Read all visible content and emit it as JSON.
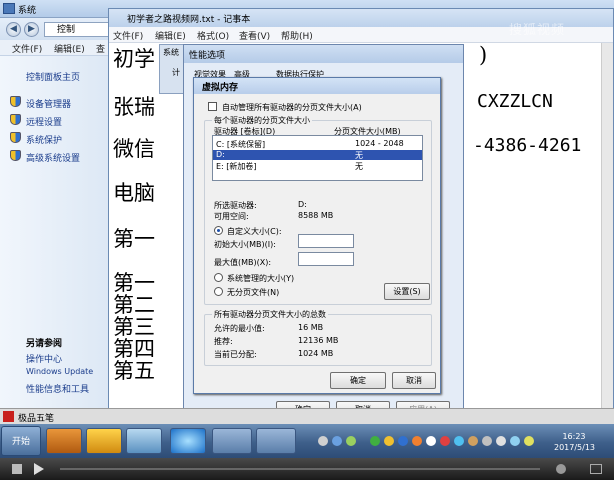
{
  "explorer": {
    "title": "系统",
    "address": "控制",
    "menu": [
      "文件(F)",
      "编辑(E)",
      "查"
    ],
    "left": {
      "home": "控制面板主页",
      "links": [
        "设备管理器",
        "远程设置",
        "系统保护",
        "高级系统设置"
      ],
      "see_also_title": "另请参阅",
      "see_also": [
        "操作中心",
        "Windows Update",
        "性能信息和工具"
      ]
    }
  },
  "notepad": {
    "title": "初学者之路视频网.txt - 记事本",
    "menu": [
      "文件(F)",
      "编辑(E)",
      "格式(O)",
      "查看(V)",
      "帮助(H)"
    ],
    "lines": [
      "初学",
      "张瑞",
      "微信",
      "电脑",
      "第一",
      "第一",
      "第二",
      "第三",
      "第四",
      "第五"
    ],
    "right_texts": [
      ")",
      "CXZZLCN",
      "-4386-4261"
    ],
    "watermark": "搜狐视频"
  },
  "sysprop": {
    "title": "系统",
    "tab": "计"
  },
  "perf": {
    "title": "性能选项",
    "tabs": [
      "视觉效果",
      "高级",
      "数据执行保护"
    ],
    "ok": "确定",
    "cancel": "取消",
    "apply": "应用(A)"
  },
  "vm": {
    "title": "虚拟内存",
    "auto_manage": "自动管理所有驱动器的分页文件大小(A)",
    "group_title": "每个驱动器的分页文件大小",
    "col_drive": "驱动器 [卷标](D)",
    "col_size": "分页文件大小(MB)",
    "rows": [
      {
        "drive": "C:   [系统保留]",
        "size": "1024 - 2048"
      },
      {
        "drive": "D:",
        "size": "无"
      },
      {
        "drive": "E:   [新加卷]",
        "size": "无"
      }
    ],
    "selected_drive_label": "所选驱动器:",
    "selected_drive_value": "D:",
    "space_label": "可用空间:",
    "space_value": "8588 MB",
    "custom": "自定义大小(C):",
    "initial": "初始大小(MB)(I):",
    "max": "最大值(MB)(X):",
    "system_managed": "系统管理的大小(Y)",
    "no_paging": "无分页文件(N)",
    "set": "设置(S)",
    "total_title": "所有驱动器分页文件大小的总数",
    "min_label": "允许的最小值:",
    "min_value": "16 MB",
    "rec_label": "推荐:",
    "rec_value": "12136 MB",
    "cur_label": "当前已分配:",
    "cur_value": "1024 MB",
    "ok": "确定",
    "cancel": "取消"
  },
  "ime": {
    "label": "极品五笔"
  },
  "taskbar": {
    "start": "开始",
    "time": "16:23",
    "date": "2017/5/13"
  }
}
